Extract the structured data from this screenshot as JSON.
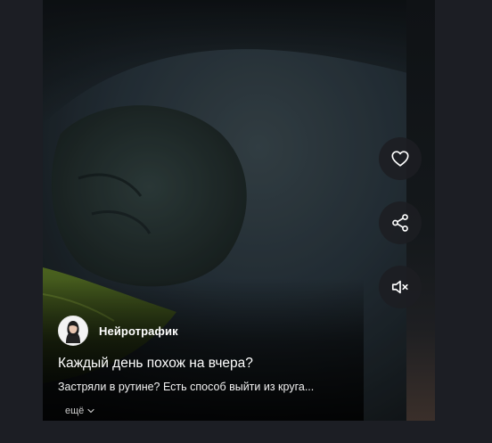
{
  "player": {
    "channel": {
      "name": "Нейротрафик",
      "avatar_icon": "avatar-woman-portrait"
    },
    "video": {
      "title": "Каждый день похож на вчера?",
      "description": "Застряли в рутине? Есть способ выйти из круга..."
    },
    "more_label": "ещё",
    "actions": [
      {
        "name": "like",
        "icon": "heart-icon"
      },
      {
        "name": "share",
        "icon": "share-icon"
      },
      {
        "name": "mute",
        "icon": "speaker-muted-icon"
      }
    ]
  },
  "colors": {
    "page_background": "#1c1e24",
    "button_background": "#1c1e22",
    "text": "#ffffff"
  }
}
